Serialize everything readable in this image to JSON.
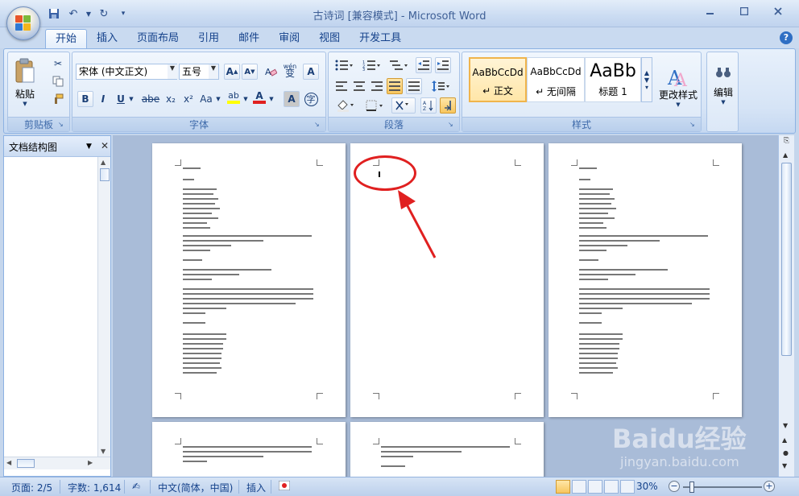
{
  "window": {
    "title": "古诗词 [兼容模式] - Microsoft Word",
    "minimize_icon": "minimize-icon",
    "maximize_icon": "maximize-icon",
    "close_icon": "close-icon"
  },
  "qat": {
    "items": [
      "save-icon",
      "undo-icon",
      "redo-icon",
      "customize-dropdown-icon"
    ]
  },
  "tabs": [
    "开始",
    "插入",
    "页面布局",
    "引用",
    "邮件",
    "审阅",
    "视图",
    "开发工具"
  ],
  "active_tab": "开始",
  "ribbon": {
    "clipboard": {
      "label": "剪贴板",
      "paste": "粘贴"
    },
    "font": {
      "label": "字体",
      "font_name": "宋体 (中文正文)",
      "font_size": "五号",
      "wen_icon_text": "wén",
      "wen_icon_char": "变",
      "a_char": "A",
      "bold": "B",
      "italic": "I",
      "underline": "U",
      "strike": "abe",
      "sub": "x₂",
      "sup": "x²",
      "case": "Aa",
      "highlight": "ab",
      "font_color": "A",
      "char_shade": "A",
      "enclose": "字"
    },
    "paragraph": {
      "label": "段落"
    },
    "styles": {
      "label": "样式",
      "items": [
        {
          "sample": "AaBbCcDd",
          "name": "↵ 正文"
        },
        {
          "sample": "AaBbCcDd",
          "name": "↵ 无间隔"
        },
        {
          "sample": "AaBb",
          "name": "标题 1"
        }
      ],
      "change_styles": "更改样式"
    },
    "editing": {
      "label": "编辑"
    }
  },
  "docmap": {
    "title": "文档结构图"
  },
  "statusbar": {
    "page": "页面: 2/5",
    "words": "字数: 1,614",
    "language": "中文(简体，中国)",
    "insert_mode": "插入",
    "zoom": "30%"
  },
  "watermark": {
    "brand": "Baidu经验",
    "url": "jingyan.baidu.com"
  },
  "colors": {
    "annotation": "#e02020",
    "ribbon_bg": "#dce8f7",
    "accent": "#15428b"
  }
}
